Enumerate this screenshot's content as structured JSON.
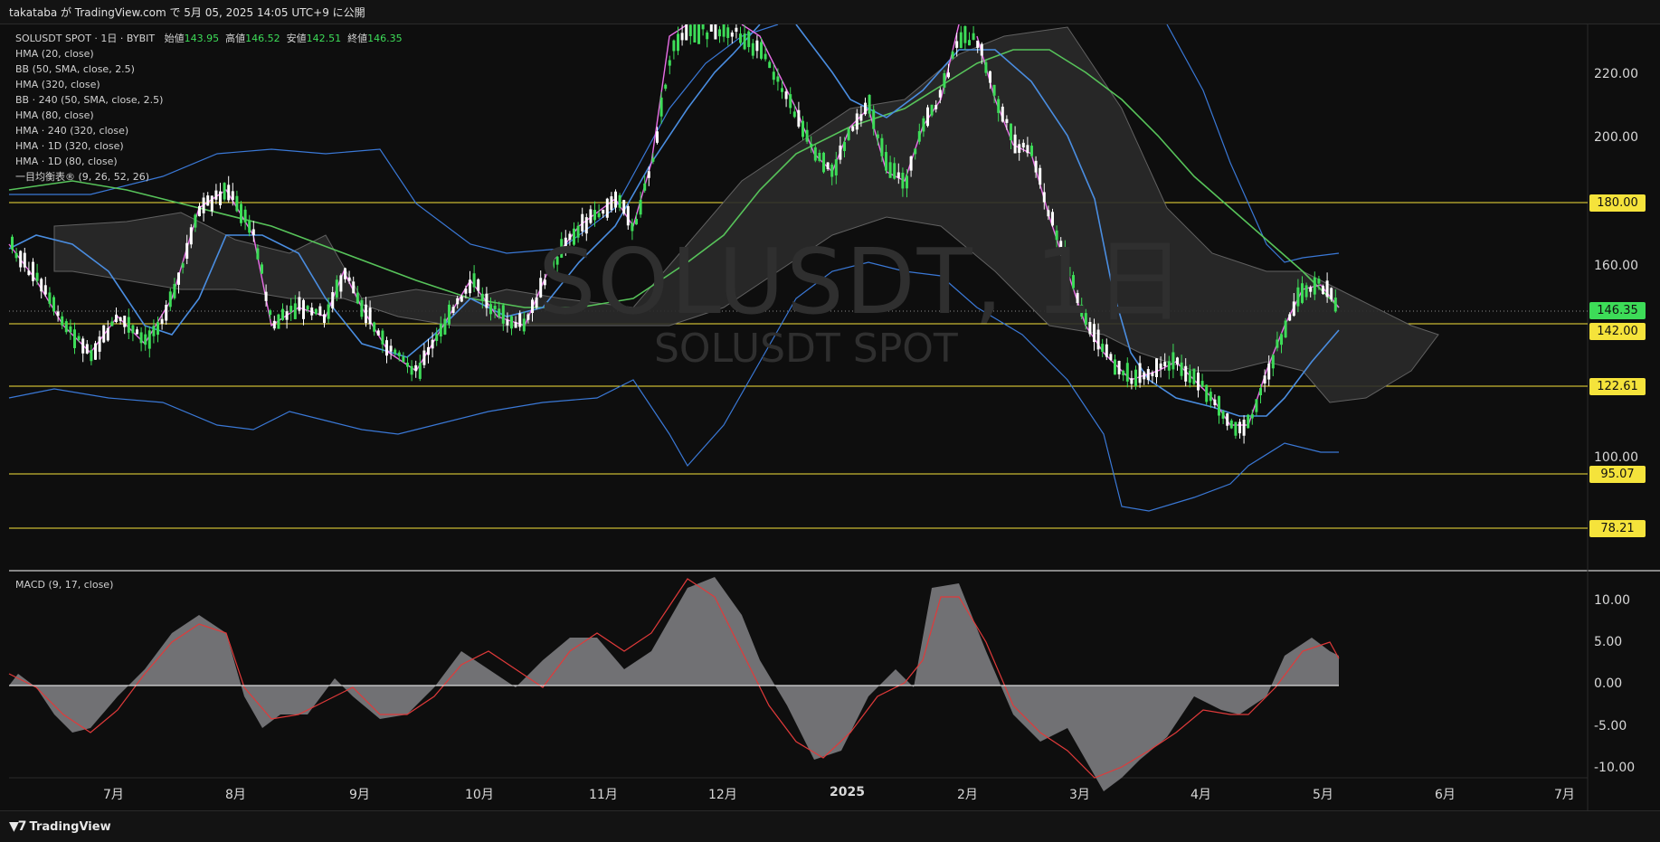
{
  "header": {
    "published": "takataba が TradingView.com で 5月 05, 2025 14:05 UTC+9 に公開"
  },
  "legend": {
    "symbol": "SOLUSDT SPOT · 1日 · BYBIT",
    "open_label": "始値",
    "open": "143.95",
    "high_label": "高値",
    "high": "146.52",
    "low_label": "安値",
    "low": "142.51",
    "close_label": "終値",
    "close": "146.35",
    "indicators": [
      "HMA (20, close)",
      "BB (50, SMA, close, 2.5)",
      "HMA (320, close)",
      "BB · 240 (50, SMA, close, 2.5)",
      "HMA (80, close)",
      "HMA · 240 (320, close)",
      "HMA · 1D (320, close)",
      "HMA · 1D (80, close)",
      "一目均衡表® (9, 26, 52, 26)"
    ]
  },
  "watermark": {
    "big": "SOLUSDT, 1日",
    "small": "SOLUSDT SPOT"
  },
  "macd": {
    "label": "MACD (9, 17, close)"
  },
  "price_axis": {
    "labels": [
      "220.00",
      "200.00",
      "160.00",
      "100.00"
    ],
    "tags": [
      {
        "value": "180.00",
        "color": "yellow"
      },
      {
        "value": "146.35",
        "color": "green"
      },
      {
        "value": "142.00",
        "color": "yellow"
      },
      {
        "value": "122.61",
        "color": "yellow"
      },
      {
        "value": "95.07",
        "color": "yellow"
      },
      {
        "value": "78.21",
        "color": "yellow"
      }
    ]
  },
  "macd_axis": {
    "labels": [
      "10.00",
      "5.00",
      "0.00",
      "-5.00",
      "-10.00"
    ]
  },
  "time_axis": {
    "labels": [
      "7月",
      "8月",
      "9月",
      "10月",
      "11月",
      "12月",
      "2025",
      "2月",
      "3月",
      "4月",
      "5月",
      "6月",
      "7月"
    ]
  },
  "footer": {
    "brand": "TradingView"
  },
  "colors": {
    "up": "#3ddc58",
    "down": "#ffffff",
    "hma_fast": "#e86ee6",
    "hma_mid": "#4a8de0",
    "hma_slow": "#57c35a",
    "bb": "#3a78d6",
    "level": "#f5e33b",
    "macd_signal": "#e03a3a",
    "macd_area": "#7c7c80"
  }
}
